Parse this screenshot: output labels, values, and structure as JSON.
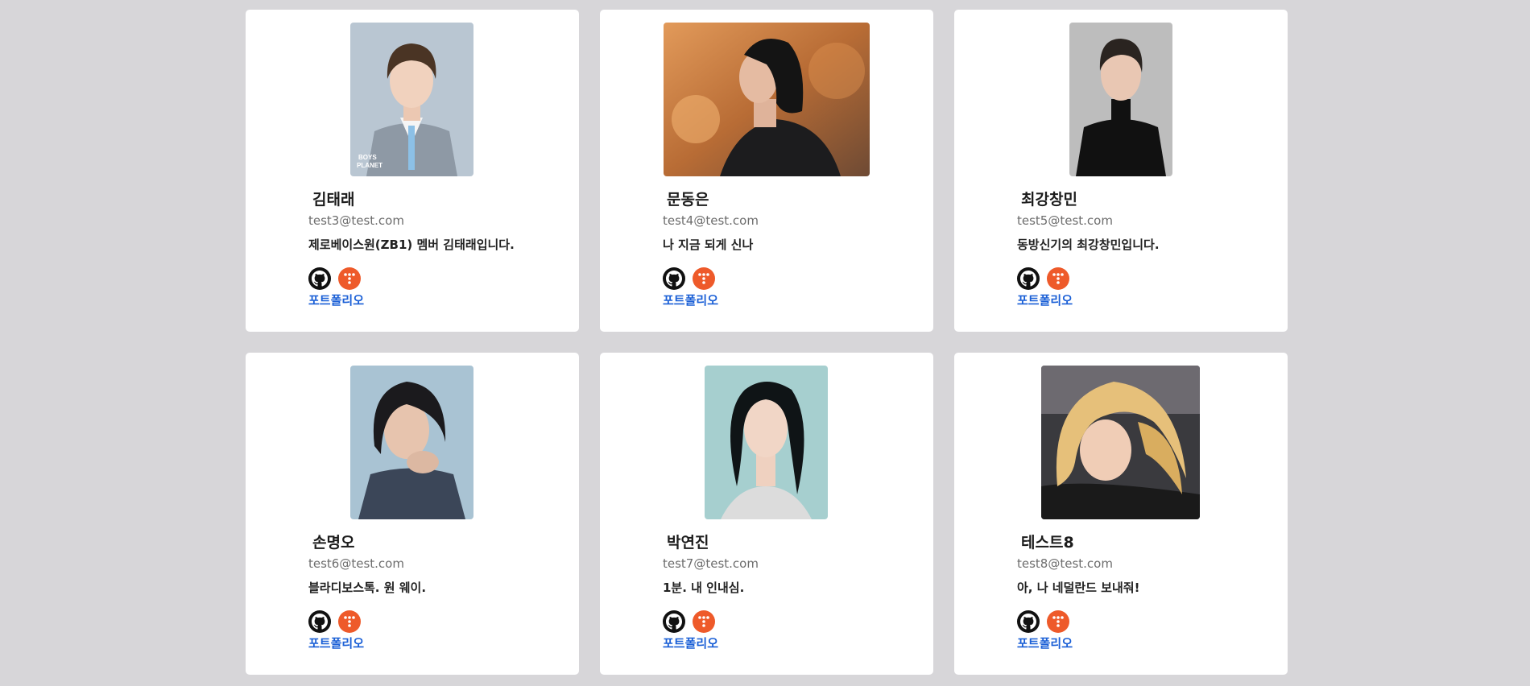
{
  "profiles": [
    {
      "name": "김태래",
      "email": "test3@test.com",
      "bio": "제로베이스원(ZB1) 멤버 김태래입니다.",
      "portfolio_label": "포트폴리오",
      "photo_caption": "BOYS PLANET",
      "photo_theme": {
        "bg": "#b7c3cf",
        "hair": "#4a3424",
        "skin": "#f1d2be",
        "clothes": "#8f9aa6"
      }
    },
    {
      "name": "문동은",
      "email": "test4@test.com",
      "bio": "나 지금 되게 신나",
      "portfolio_label": "포트폴리오",
      "photo_theme": {
        "bg": "#c9844a",
        "hair": "#151515",
        "skin": "#e5bba2",
        "clothes": "#1d1d1f"
      }
    },
    {
      "name": "최강창민",
      "email": "test5@test.com",
      "bio": "동방신기의 최강창민입니다.",
      "portfolio_label": "포트폴리오",
      "photo_theme": {
        "bg": "#bdbdbd",
        "hair": "#2a2420",
        "skin": "#e9c7b3",
        "clothes": "#111111"
      }
    },
    {
      "name": "손명오",
      "email": "test6@test.com",
      "bio": "블라디보스톡. 원 웨이.",
      "portfolio_label": "포트폴리오",
      "photo_theme": {
        "bg": "#a9c3d3",
        "hair": "#1b1a1d",
        "skin": "#e7c4ae",
        "clothes": "#3b4658"
      }
    },
    {
      "name": "박연진",
      "email": "test7@test.com",
      "bio": "1분. 내 인내심.",
      "portfolio_label": "포트폴리오",
      "photo_theme": {
        "bg": "#a6cfcf",
        "hair": "#0f1416",
        "skin": "#f1d6c6",
        "clothes": "#d9d9d9"
      }
    },
    {
      "name": "테스트8",
      "email": "test8@test.com",
      "bio": "아, 나 네덜란드 보내줘!",
      "portfolio_label": "포트폴리오",
      "photo_theme": {
        "bg": "#3a3a3e",
        "hair": "#e6c07a",
        "skin": "#f0cdb6",
        "clothes": "#1a1a1a"
      }
    }
  ],
  "icons": {
    "github": "github-icon",
    "tistory": "tistory-icon"
  },
  "colors": {
    "page_bg": "#d7d6d9",
    "card_bg": "#ffffff",
    "link": "#1a5fd6",
    "tistory": "#ee5a2a"
  }
}
